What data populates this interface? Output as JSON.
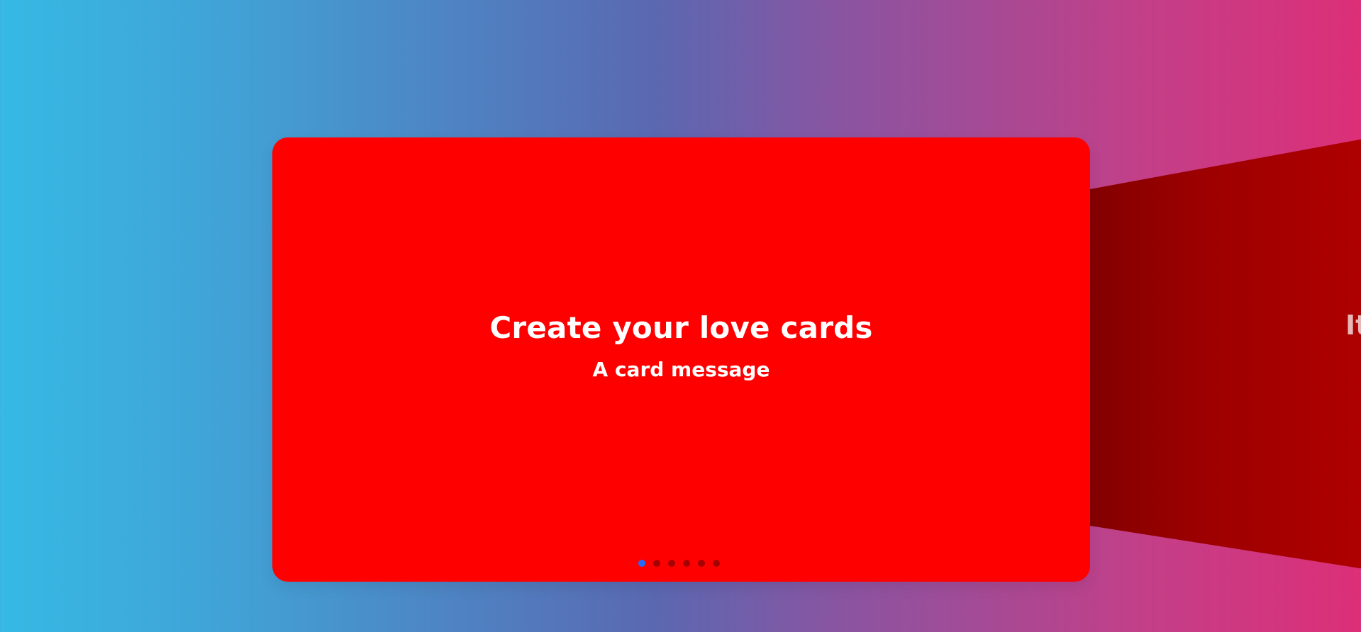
{
  "carousel": {
    "current_index": 1,
    "total_slides": 6,
    "slides": [
      {
        "title": "Create your love cards",
        "message": "A card message",
        "color": "#ff0000"
      },
      {
        "title": "It",
        "color": "#a00000"
      }
    ],
    "pagination": {
      "active_color": "#1f6dff",
      "inactive_color": "#000000",
      "dots": [
        {
          "index": 1,
          "active": true
        },
        {
          "index": 2,
          "active": false
        },
        {
          "index": 3,
          "active": false
        },
        {
          "index": 4,
          "active": false
        },
        {
          "index": 5,
          "active": false
        },
        {
          "index": 6,
          "active": false
        }
      ]
    }
  },
  "background": {
    "gradient_colors": [
      "#36b9e4",
      "#5a68b1",
      "#dc2f78"
    ]
  }
}
